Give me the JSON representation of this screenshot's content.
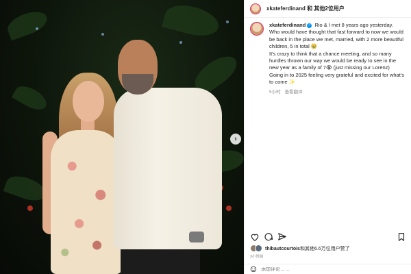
{
  "post": {
    "username": "xkateferdinand",
    "header_text": "xkateferdinand 和 其他2位用户",
    "caption_lines": [
      "Rio & I met 8 years ago yesterday.",
      "Who would have thought that fast forward to now we would be back in the place we met, married, with 2 more beautiful children, 5 in total 🥹",
      "It's crazy to think that a chance meeting, and so many hurdles thrown our way we would be ready to see in the new year as a family of 7😭 (just missing our Lorenz)",
      "Going in to 2025 feeling very grateful and excited for what's to come ✨"
    ],
    "time_ago": "5小时",
    "see_translation": "查看翻译",
    "likes_text": "thibautcourtois和其他6.6万位用户赞了",
    "likes_user": "thibautcourtois",
    "likes_rest": "和其他6.6万位用户赞了",
    "posted_ago": "3小时前",
    "comment_placeholder": "添加评论……"
  },
  "icons": {
    "next": "chevron-right-icon",
    "like": "heart-icon",
    "comment": "comment-icon",
    "share": "paper-plane-icon",
    "save": "bookmark-icon",
    "emoji": "smiley-icon",
    "verified": "verified-badge-icon"
  },
  "colors": {
    "verified": "#0095f6",
    "story_ring": "#e1306c",
    "muted_text": "#8e8e8e"
  }
}
